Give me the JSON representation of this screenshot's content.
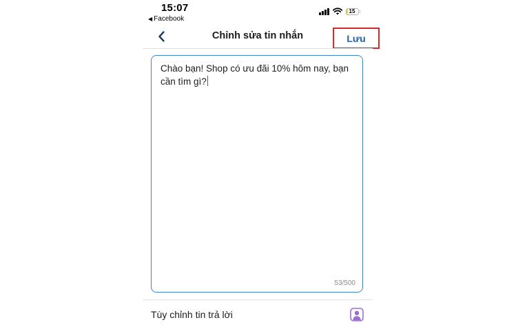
{
  "status_bar": {
    "time": "15:07",
    "back_app_label": "Facebook",
    "battery_level": "15",
    "battery_fraction": 0.15
  },
  "header": {
    "title": "Chỉnh sửa tin nhắn",
    "save_label": "Lưu",
    "back_icon": "chevron-left-icon"
  },
  "editor": {
    "value": "Chào bạn! Shop có ưu đãi 10% hôm nay, bạn cần tìm gì?",
    "char_count": "53/500"
  },
  "custom_reply": {
    "label": "Tùy chỉnh tin trả lời",
    "icon": "person-icon"
  },
  "colors": {
    "accent_blue": "#1f5fa8",
    "editor_border": "#3a86c8",
    "highlight_red": "#d62a2a",
    "icon_purple": "#9b6fd0"
  }
}
